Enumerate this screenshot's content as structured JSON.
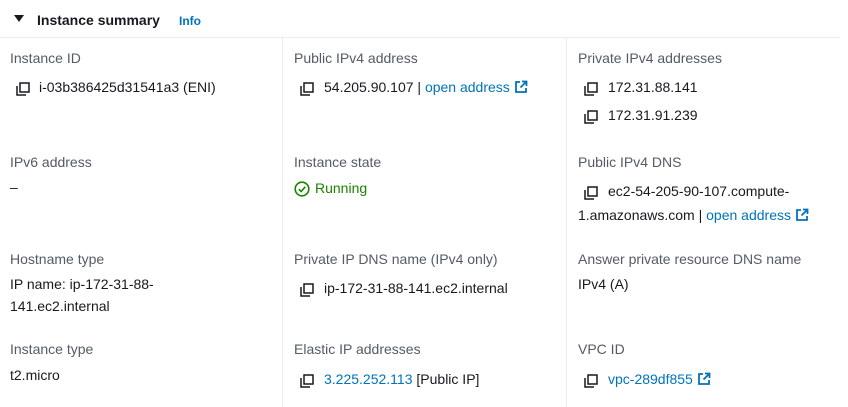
{
  "header": {
    "title": "Instance summary",
    "info": "Info"
  },
  "col1": {
    "instance_id": {
      "label": "Instance ID",
      "value": "i-03b386425d31541a3 (ENI)"
    },
    "ipv6": {
      "label": "IPv6 address",
      "value": "–"
    },
    "hostname_type": {
      "label": "Hostname type",
      "line1": "IP name: ip-172-31-88-",
      "line2": "141.ec2.internal"
    },
    "instance_type": {
      "label": "Instance type",
      "value": "t2.micro"
    }
  },
  "col2": {
    "public_ipv4": {
      "label": "Public IPv4 address",
      "value": "54.205.90.107",
      "separator": "|",
      "link": "open address"
    },
    "state": {
      "label": "Instance state",
      "value": "Running"
    },
    "private_dns": {
      "label": "Private IP DNS name (IPv4 only)",
      "value": "ip-172-31-88-141.ec2.internal"
    },
    "elastic_ip": {
      "label": "Elastic IP addresses",
      "link": "3.225.252.113",
      "suffix": "[Public IP]"
    }
  },
  "col3": {
    "private_ipv4": {
      "label": "Private IPv4 addresses",
      "values": [
        "172.31.88.141",
        "172.31.91.239"
      ]
    },
    "public_dns": {
      "label": "Public IPv4 DNS",
      "line1": "ec2-54-205-90-107.compute-",
      "line2": "1.amazonaws.com",
      "separator": "|",
      "link": "open address"
    },
    "answer_dns": {
      "label": "Answer private resource DNS name",
      "value": "IPv4 (A)"
    },
    "vpc": {
      "label": "VPC ID",
      "link": "vpc-289df855"
    }
  },
  "colors": {
    "link": "#0073bb",
    "success": "#1d8102",
    "label": "#545b64",
    "text": "#16191f",
    "divider": "#eaeded"
  },
  "icons": [
    "caret-down-icon",
    "copy-icon",
    "external-link-icon",
    "status-check-icon"
  ]
}
